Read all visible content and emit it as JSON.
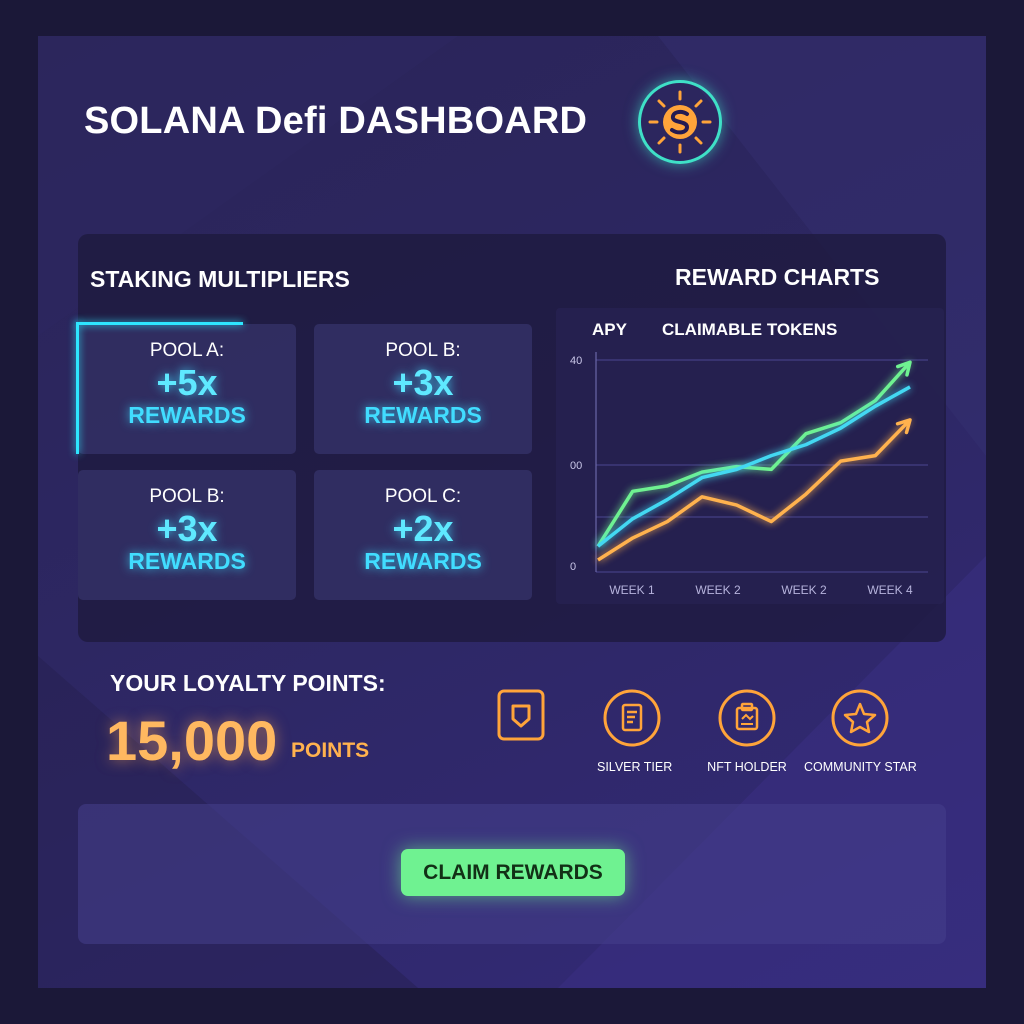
{
  "header": {
    "title": "SOLANA Defi DASHBOARD",
    "logo_icon": "solana-sun-logo-icon"
  },
  "staking": {
    "title": "STAKING MULTIPLIERS",
    "pools": [
      {
        "name": "POOL A:",
        "multiplier": "+5x",
        "label": "REWARDS",
        "active": true
      },
      {
        "name": "POOL B:",
        "multiplier": "+3x",
        "label": "REWARDS",
        "active": false
      },
      {
        "name": "POOL B:",
        "multiplier": "+3x",
        "label": "REWARDS",
        "active": false
      },
      {
        "name": "POOL C:",
        "multiplier": "+2x",
        "label": "REWARDS",
        "active": false
      }
    ]
  },
  "chart_data": {
    "type": "line",
    "title": "REWARD CHARTS",
    "legend": [
      "APY",
      "CLAIMABLE TOKENS"
    ],
    "x": [
      "WEEK 1",
      "WEEK 2",
      "WEEK 2",
      "WEEK 4"
    ],
    "y_tick_labels": [
      "40",
      "00",
      "0"
    ],
    "series": [
      {
        "color": "#6ff291",
        "values": [
          5,
          25,
          27,
          32,
          34,
          33,
          46,
          50,
          58,
          72
        ]
      },
      {
        "color": "#43d8f2",
        "values": [
          5,
          15,
          22,
          30,
          33,
          38,
          42,
          48,
          56,
          63
        ]
      },
      {
        "color": "#ffb24e",
        "values": [
          0,
          8,
          14,
          23,
          20,
          14,
          24,
          36,
          38,
          51
        ]
      }
    ],
    "ylim": [
      0,
      75
    ],
    "grid": true
  },
  "loyalty": {
    "label": "YOUR LOYALTY POINTS:",
    "points": "15,000",
    "unit": "POINTS",
    "badges": [
      {
        "icon": "shield-icon",
        "label": ""
      },
      {
        "icon": "tier-document-icon",
        "label": "SILVER TIER"
      },
      {
        "icon": "nft-icon",
        "label": "NFT HOLDER"
      },
      {
        "icon": "star-icon",
        "label": "COMMUNITY STAR"
      }
    ]
  },
  "actions": {
    "claim_label": "CLAIM REWARDS"
  }
}
